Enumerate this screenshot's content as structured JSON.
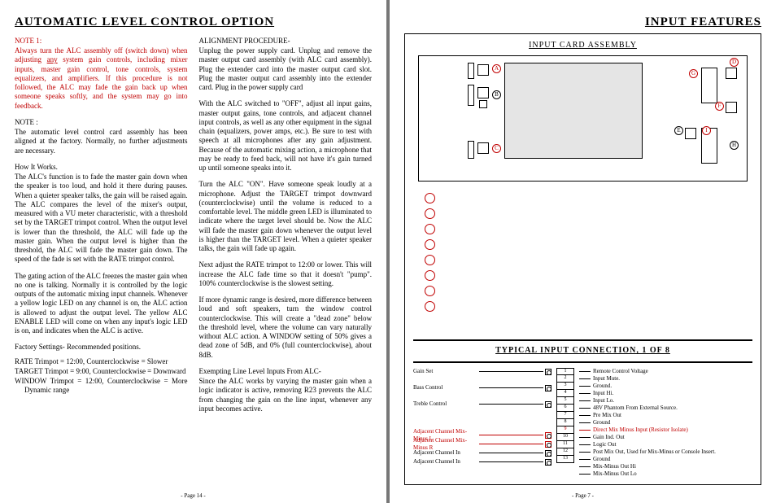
{
  "left": {
    "title": "AUTOMATIC  LEVEL  CONTROL  OPTION",
    "col1": {
      "note1_head": "NOTE 1:",
      "note1_body_a": "Always turn the ALC assembly off (switch down) when adjusting ",
      "note1_body_u": "any",
      "note1_body_b": " system gain controls, including mixer inputs, master gain control, tone controls, system equalizers, and amplifiers. If this procedure is not followed, the ALC may fade the gain back up when someone speaks softly, and the system may go into feedback.",
      "note2_head": "NOTE :",
      "note2_body": "The automatic level control card assembly has been aligned at the factory. Normally, no further adjustments are necessary.",
      "hiw_head": "How It Works.",
      "hiw_body": "The ALC's function is to fade the master gain down when the speaker is too loud, and hold it there during pauses. When a quieter speaker talks, the gain will be raised again. The ALC compares the level of the mixer's output, measured with a VU meter characteristic, with a threshold set by the TARGET  trimpot control. When the output level is lower than the threshold, the ALC will fade up the master gain. When the output level is higher than the threshold, the ALC will fade the master gain down. The speed of the fade is set with the RATE trimpot control.",
      "gate_body": "The gating action of the ALC freezes the master gain when no one is talking. Normally it is controlled by the logic outputs of the automatic mixing input channels. Whenever a yellow logic LED on any channel is on, the ALC action is allowed to adjust the output level. The yellow ALC ENABLE LED will come on when any input's logic LED is on, and indicates when the ALC is active.",
      "fs_head": "Factory Settings- Recommended positions.",
      "fs_1": "RATE Trimpot = 12:00, Counterclockwise = Slower",
      "fs_2": "TARGET Trimpot = 9:00, Counterclockwise = Downward",
      "fs_3": "WINDOW Trimpot = 12:00, Counterclockwise = More Dynamic range"
    },
    "col2": {
      "align_head": "ALIGNMENT PROCEDURE-",
      "align_1": "Unplug the power supply card. Unplug and remove the master output card assembly (with ALC card assembly). Plug the extender card into the master output card slot. Plug the master output card assembly into the extender card. Plug in the power supply card",
      "align_2": "With the ALC switched to \"OFF\", adjust all input gains, master output gains, tone controls, and adjacent channel input controls, as well as any other equipment in the signal chain (equalizers, power amps, etc.). Be sure to test with speech at all microphones after any gain adjustment. Because of the automatic mixing action, a microphone that may be ready to feed back, will not have it's gain turned up until someone speaks into it.",
      "align_3": "Turn the ALC \"ON\". Have someone speak loudly at a microphone. Adjust the TARGET trimpot downward (counterclockwise) until the volume is reduced to a comfortable level. The middle green LED is illuminated to indicate where the target level should be.  Now the ALC will fade the master gain down whenever the output level is higher than the TARGET level. When a quieter speaker talks, the gain will fade up again.",
      "align_4": "Next adjust the RATE trimpot to 12:00 or lower. This will increase the ALC fade time so that it doesn't  \"pump\". 100% counterclockwise is the slowest setting.",
      "align_5": "If more dynamic range is desired, more difference between loud and soft speakers, turn the window control counterclockwise. This will create a \"dead zone\" below the threshold level, where the volume can vary naturally without ALC action. A WINDOW setting of 50% gives a dead zone of 5dB, and 0% (full counterclockwise), about 8dB.",
      "exempt_head": "Exempting Line Level Inputs From ALC-",
      "exempt_body": "Since the ALC works by varying the master gain when a logic indicator is active, removing R23 prevents the ALC from changing the gain on the line input, whenever any input becomes active."
    },
    "footer": "- Page  14 -"
  },
  "right": {
    "title": "INPUT FEATURES",
    "assembly_title": "INPUT  CARD  ASSEMBLY",
    "badges": {
      "A": "A",
      "B": "B",
      "C": "C",
      "D": "D",
      "E": "E",
      "F": "F",
      "G": "G",
      "H": "H",
      "I": "I"
    },
    "typical_title": "TYPICAL  INPUT  CONNECTION,  1  OF  8",
    "left_controls": [
      {
        "label": "Gain  Set",
        "icon": true
      },
      {
        "label": "Bass  Control",
        "icon": true
      },
      {
        "label": "Treble  Control",
        "icon": true
      }
    ],
    "left_adj": [
      {
        "label": "Adjacent  Channel  Mix-Minus L",
        "icon": true,
        "red": true
      },
      {
        "label": "Adjacent Channel Mix-Minus R",
        "icon": true,
        "red": true
      },
      {
        "label": "Adjacent  Channel  In",
        "icon": true
      },
      {
        "label": "Adjacent  Channel  In",
        "icon": true
      }
    ],
    "pins": [
      "1",
      "2",
      "3",
      "4",
      "5",
      "6",
      "7",
      "8",
      "9",
      "10",
      "11",
      "12",
      "13"
    ],
    "pin_desc": [
      {
        "t": "Remote  Control Voltage"
      },
      {
        "t": "Input Mute."
      },
      {
        "t": "Ground."
      },
      {
        "t": "Input Hi."
      },
      {
        "t": "Input Lo."
      },
      {
        "t": "48V Phantom From External Source."
      },
      {
        "t": "Pre Mix Out"
      },
      {
        "t": "Ground"
      },
      {
        "t": "Direct Mix Minus Input (Resistor Isolate)",
        "red": true
      },
      {
        "t": "Gain Ind. Out"
      },
      {
        "t": "Logic Out"
      },
      {
        "t": "Post Mix Out, Used for Mix-Minus or Console Insert."
      },
      {
        "t": "Ground"
      },
      {
        "t": "Mix-Minus Out Hi"
      },
      {
        "t": "Mix-Minus Out Lo"
      }
    ],
    "footer": "- Page  7 -"
  }
}
